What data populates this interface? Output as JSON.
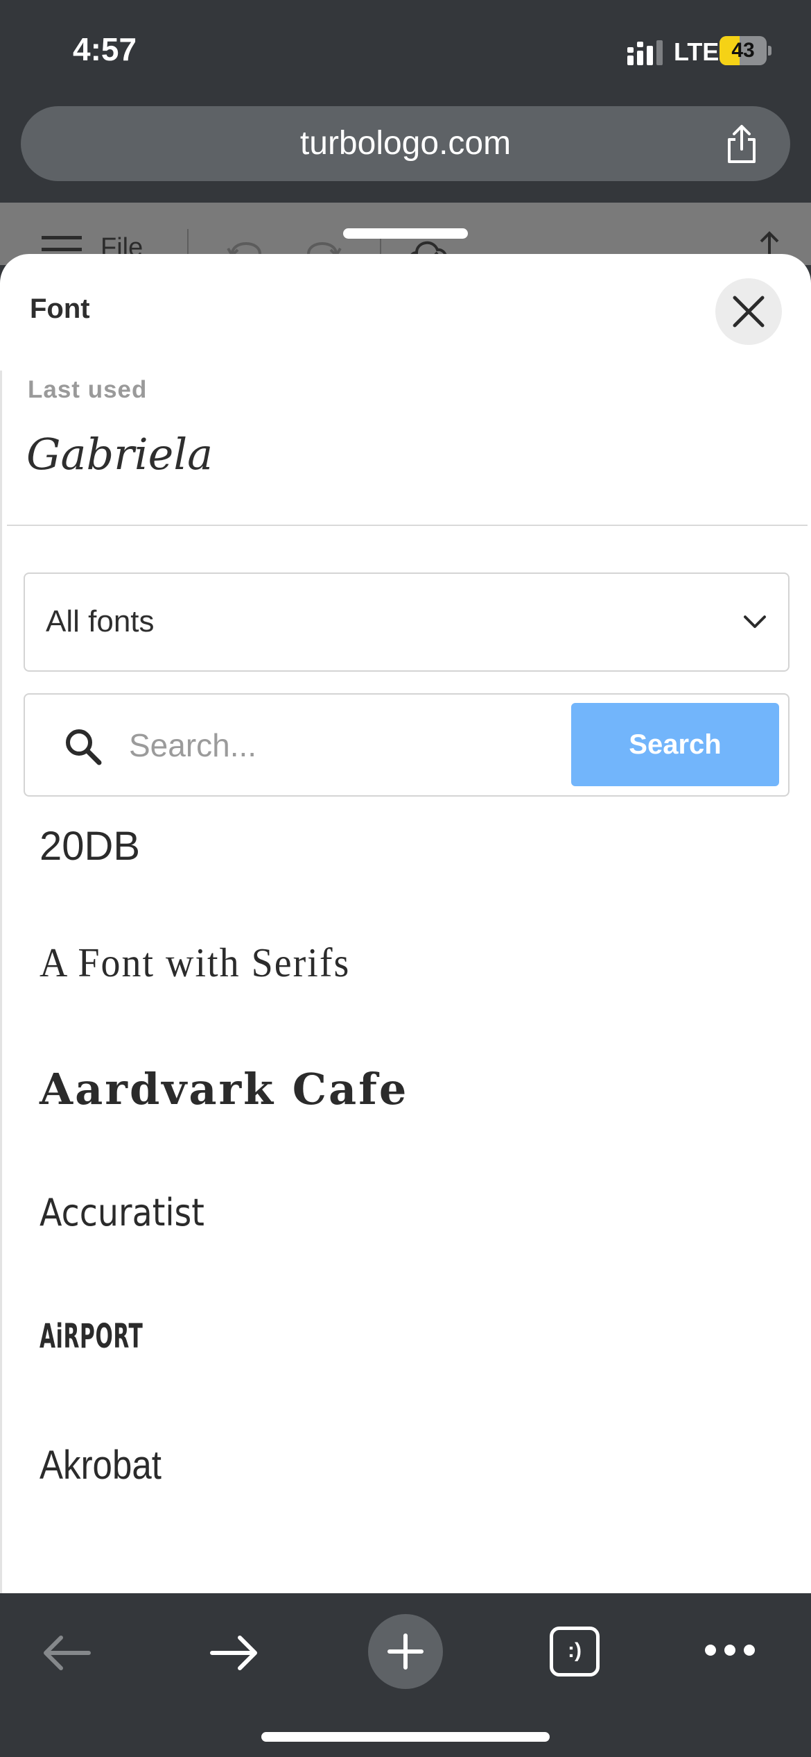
{
  "status_bar": {
    "time": "4:57",
    "network": "LTE",
    "battery_percent": 43,
    "battery_label": "43",
    "battery_color": "#f5d216"
  },
  "browser": {
    "url": "turbologo.com",
    "toolbar": {
      "file_label": "File"
    }
  },
  "font_sheet": {
    "title": "Font",
    "last_used": {
      "label": "Last used",
      "font_name": "Gabriela"
    },
    "category_select": {
      "value": "All fonts"
    },
    "search": {
      "placeholder": "Search...",
      "value": "",
      "button_label": "Search"
    },
    "fonts": [
      "20DB",
      "A Font with Serifs",
      "Aardvark Cafe",
      "Accuratist",
      "AiRPORT",
      "Akrobat"
    ]
  },
  "bottom_nav": {
    "tabs_label": ":)"
  },
  "colors": {
    "chrome_bg": "#34373b",
    "url_bar_bg": "#5e6266",
    "search_button": "#72b5fb",
    "sheet_bg": "#ffffff"
  },
  "icons": [
    "signal-icon",
    "battery-icon",
    "share-icon",
    "menu-icon",
    "undo-icon",
    "redo-icon",
    "cloud-icon",
    "upload-icon",
    "close-icon",
    "chevron-down-icon",
    "search-icon",
    "back-icon",
    "forward-icon",
    "plus-icon",
    "more-icon"
  ]
}
